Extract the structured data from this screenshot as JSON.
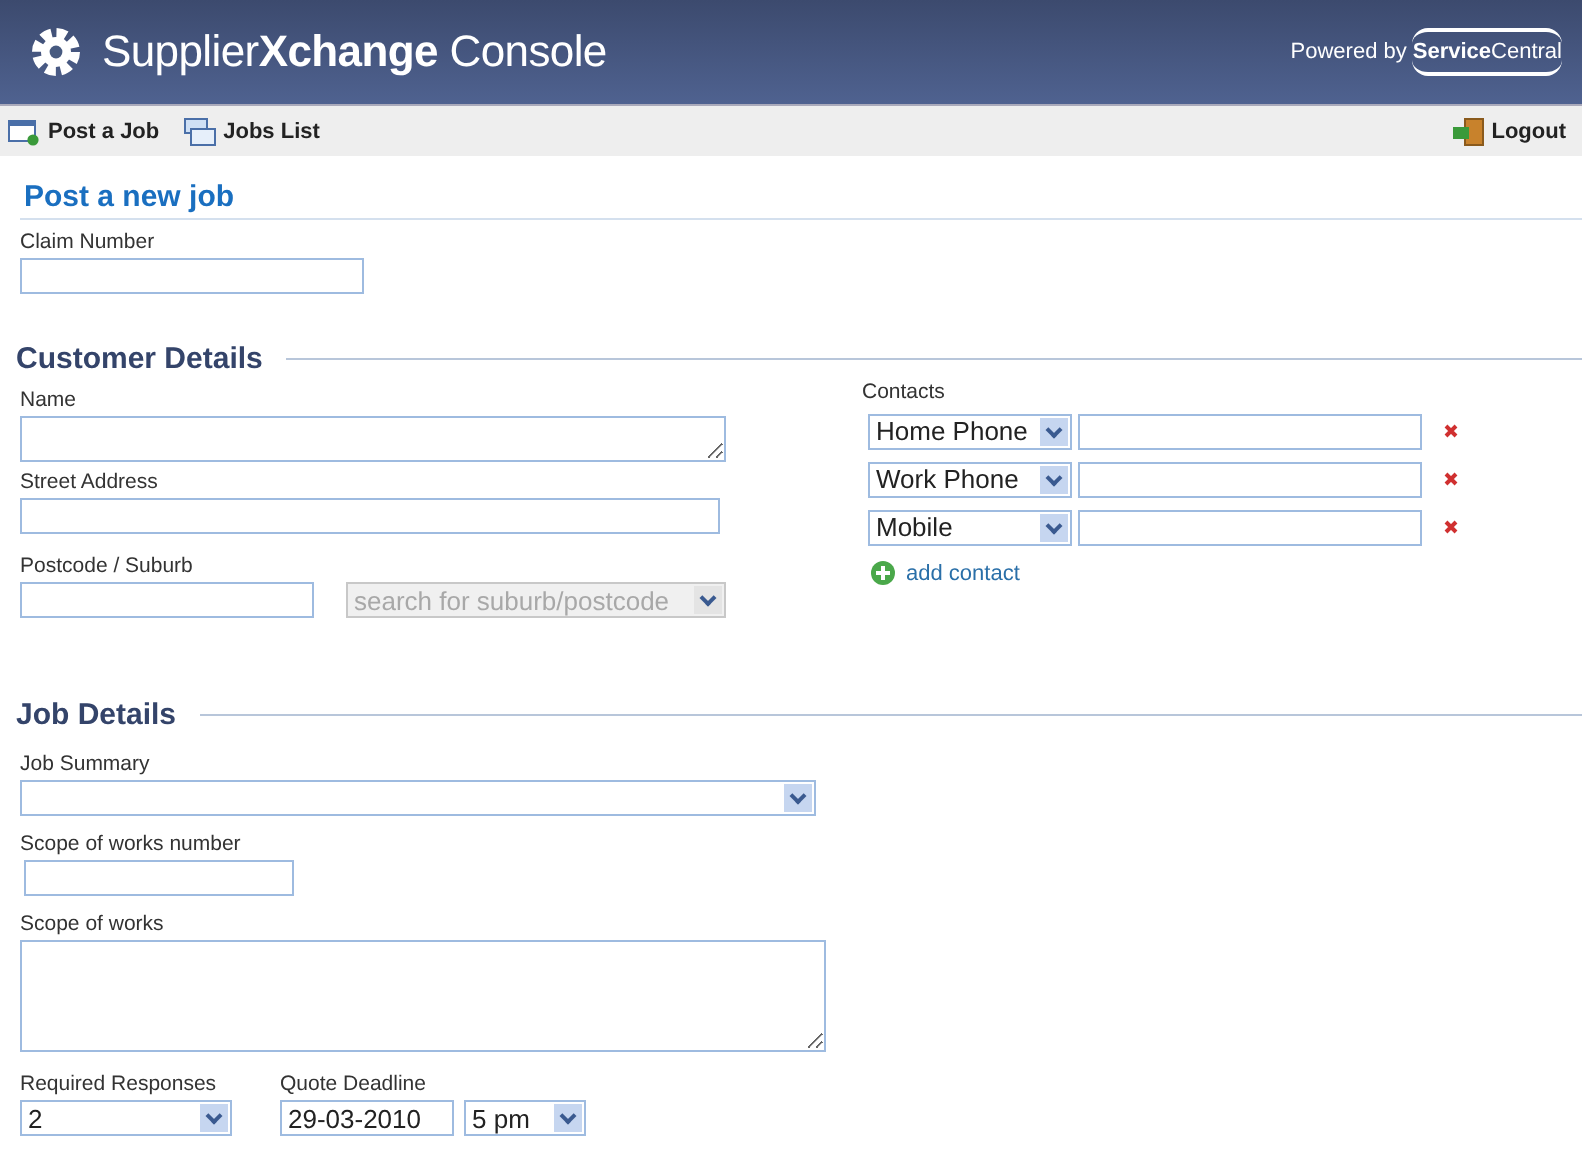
{
  "header": {
    "title": "Supplier**Xchange** Console",
    "powered_by": "Powered by",
    "brand": "**Service**Central"
  },
  "toolbar": {
    "items": [
      {
        "label": "Post a Job",
        "kind": "post"
      },
      {
        "label": "Jobs List",
        "kind": "list"
      }
    ],
    "logout": "Logout"
  },
  "page_title": "Post a new job",
  "claim": {
    "label": "Claim Number"
  },
  "customer_details": {
    "heading": "Customer Details",
    "name": {
      "label": "Name"
    },
    "street": {
      "label": "Street Address"
    },
    "postcode": {
      "label": "Postcode / Suburb",
      "suburb": "search for suburb/postcode",
      "suburb_disabled": true
    },
    "contacts": {
      "label": "Contacts",
      "rows": [
        {
          "type": "Home Phone"
        },
        {
          "type": "Work Phone"
        },
        {
          "type": "Mobile"
        }
      ],
      "add": "add contact"
    }
  },
  "job_details": {
    "heading": "Job Details",
    "summary": {
      "label": "Job Summary"
    },
    "scope_number": {
      "label": "Scope of works number"
    },
    "scope": {
      "label": "Scope of works"
    },
    "required_responses": {
      "label": "Required Responses",
      "value": "2"
    },
    "quote_deadline": {
      "label": "Quote Deadline",
      "date": "29-03-2010",
      "time": "5 pm"
    }
  }
}
